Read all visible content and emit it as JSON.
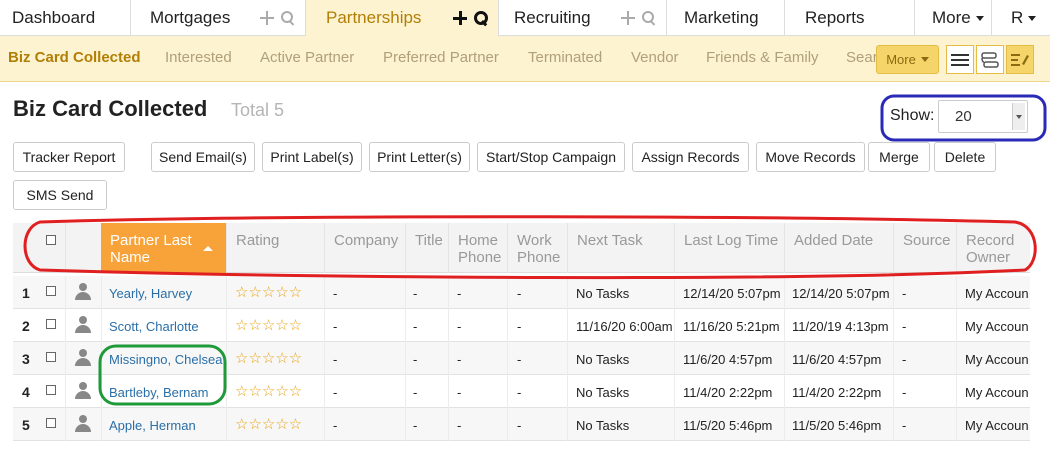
{
  "topnav": {
    "items": [
      {
        "label": "Dashboard"
      },
      {
        "label": "Mortgages"
      },
      {
        "label": "Partnerships"
      },
      {
        "label": "Recruiting"
      },
      {
        "label": "Marketing"
      },
      {
        "label": "Reports"
      },
      {
        "label": "More"
      },
      {
        "label": "R"
      }
    ]
  },
  "subnav": {
    "items": [
      {
        "label": "Biz Card Collected"
      },
      {
        "label": "Interested"
      },
      {
        "label": "Active Partner"
      },
      {
        "label": "Preferred Partner"
      },
      {
        "label": "Terminated"
      },
      {
        "label": "Vendor"
      },
      {
        "label": "Friends & Family"
      },
      {
        "label": "Sear"
      }
    ],
    "more_label": "More"
  },
  "page": {
    "title": "Biz Card Collected",
    "total": "Total 5",
    "show_label": "Show:",
    "show_value": "20"
  },
  "toolbar": {
    "tracker_report": "Tracker Report",
    "send_emails": "Send Email(s)",
    "print_labels": "Print Label(s)",
    "print_letters": "Print Letter(s)",
    "start_stop": "Start/Stop Campaign",
    "assign": "Assign Records",
    "move": "Move Records",
    "merge": "Merge",
    "delete": "Delete",
    "sms": "SMS Send"
  },
  "table": {
    "headers": {
      "name": "Partner Last Name",
      "rating": "Rating",
      "company": "Company",
      "title": "Title",
      "home_phone": "Home Phone",
      "work_phone": "Work Phone",
      "next_task": "Next Task",
      "last_log": "Last Log Time",
      "added": "Added Date",
      "source": "Source",
      "owner": "Record Owner"
    },
    "rows": [
      {
        "num": "1",
        "name": "Yearly, Harvey",
        "stars": "☆☆☆☆☆",
        "company": "-",
        "title": "-",
        "home": "-",
        "work": "-",
        "next_task": "No Tasks",
        "last_log": "12/14/20 5:07pm",
        "added": "12/14/20 5:07pm",
        "source": "-",
        "owner": "My Accoun"
      },
      {
        "num": "2",
        "name": "Scott, Charlotte",
        "stars": "☆☆☆☆☆",
        "company": "-",
        "title": "-",
        "home": "-",
        "work": "-",
        "next_task": "11/16/20 6:00am",
        "last_log": "11/16/20 5:21pm",
        "added": "11/20/19 4:13pm",
        "source": "-",
        "owner": "My Accoun"
      },
      {
        "num": "3",
        "name": "Missingno, Chelsea",
        "stars": "☆☆☆☆☆",
        "company": "-",
        "title": "-",
        "home": "-",
        "work": "-",
        "next_task": "No Tasks",
        "last_log": "11/6/20 4:57pm",
        "added": "11/6/20 4:57pm",
        "source": "-",
        "owner": "My Accoun"
      },
      {
        "num": "4",
        "name": "Bartleby, Bernam",
        "stars": "☆☆☆☆☆",
        "company": "-",
        "title": "-",
        "home": "-",
        "work": "-",
        "next_task": "No Tasks",
        "last_log": "11/4/20 2:22pm",
        "added": "11/4/20 2:22pm",
        "source": "-",
        "owner": "My Accoun"
      },
      {
        "num": "5",
        "name": "Apple, Herman",
        "stars": "☆☆☆☆☆",
        "company": "-",
        "title": "-",
        "home": "-",
        "work": "-",
        "next_task": "No Tasks",
        "last_log": "11/5/20 5:46pm",
        "added": "11/5/20 5:46pm",
        "source": "-",
        "owner": "My Accoun"
      }
    ]
  },
  "colors": {
    "accent": "#b27f06",
    "subnav_bg": "#fdf3d0",
    "sort_header": "#f8a33a",
    "link": "#2a6fa8",
    "star": "#e8a317",
    "annotation_blue": "#2a2ab8",
    "annotation_red": "#e02020",
    "annotation_green": "#1f9a3a"
  }
}
